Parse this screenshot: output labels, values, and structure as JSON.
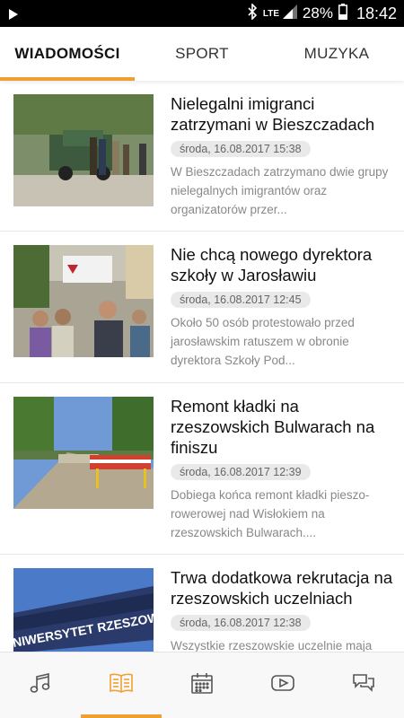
{
  "status_bar": {
    "lte": "LTE",
    "battery": "28%",
    "time": "18:42",
    "icons": [
      "play-icon",
      "bluetooth-icon",
      "signal-icon",
      "battery-icon"
    ]
  },
  "tabs": [
    {
      "label": "WIADOMOŚCI",
      "active": true
    },
    {
      "label": "SPORT",
      "active": false
    },
    {
      "label": "MUZYKA",
      "active": false
    }
  ],
  "articles": [
    {
      "title": "Nielegalni imigranci zatrzymani w Bieszczadach",
      "date": "środa, 16.08.2017 15:38",
      "excerpt": "W Bieszczadach zatrzymano dwie grupy nielegalnych imigrantów oraz organizatorów przer..."
    },
    {
      "title": "Nie chcą nowego dyrektora szkoły w Jarosławiu",
      "date": "środa, 16.08.2017 12:45",
      "excerpt": "Około 50 osób protestowało przed jarosławskim ratuszem w obronie dyrektora Szkoły Pod..."
    },
    {
      "title": "Remont kładki na rzeszowskich Bulwarach na finiszu",
      "date": "środa, 16.08.2017 12:39",
      "excerpt": "Dobiega końca remont kładki pieszo-rowerowej nad Wisłokiem na rzeszowskich Bulwarach...."
    },
    {
      "title": "Trwa dodatkowa rekrutacja na rzeszowskich uczelniach",
      "date": "środa, 16.08.2017 12:38",
      "excerpt": "Wszystkie rzeszowskie uczelnie maja",
      "image_text": "NIWERSYTET RZESZOWSK"
    }
  ],
  "bottom_nav": [
    {
      "icon": "music-note-icon",
      "active": false
    },
    {
      "icon": "news-book-icon",
      "active": true
    },
    {
      "icon": "calendar-icon",
      "active": false
    },
    {
      "icon": "youtube-icon",
      "active": false
    },
    {
      "icon": "chat-icon",
      "active": false
    }
  ],
  "colors": {
    "accent": "#f0a030",
    "title": "#111111",
    "excerpt": "#888888",
    "date_pill": "#e9e9e9"
  }
}
